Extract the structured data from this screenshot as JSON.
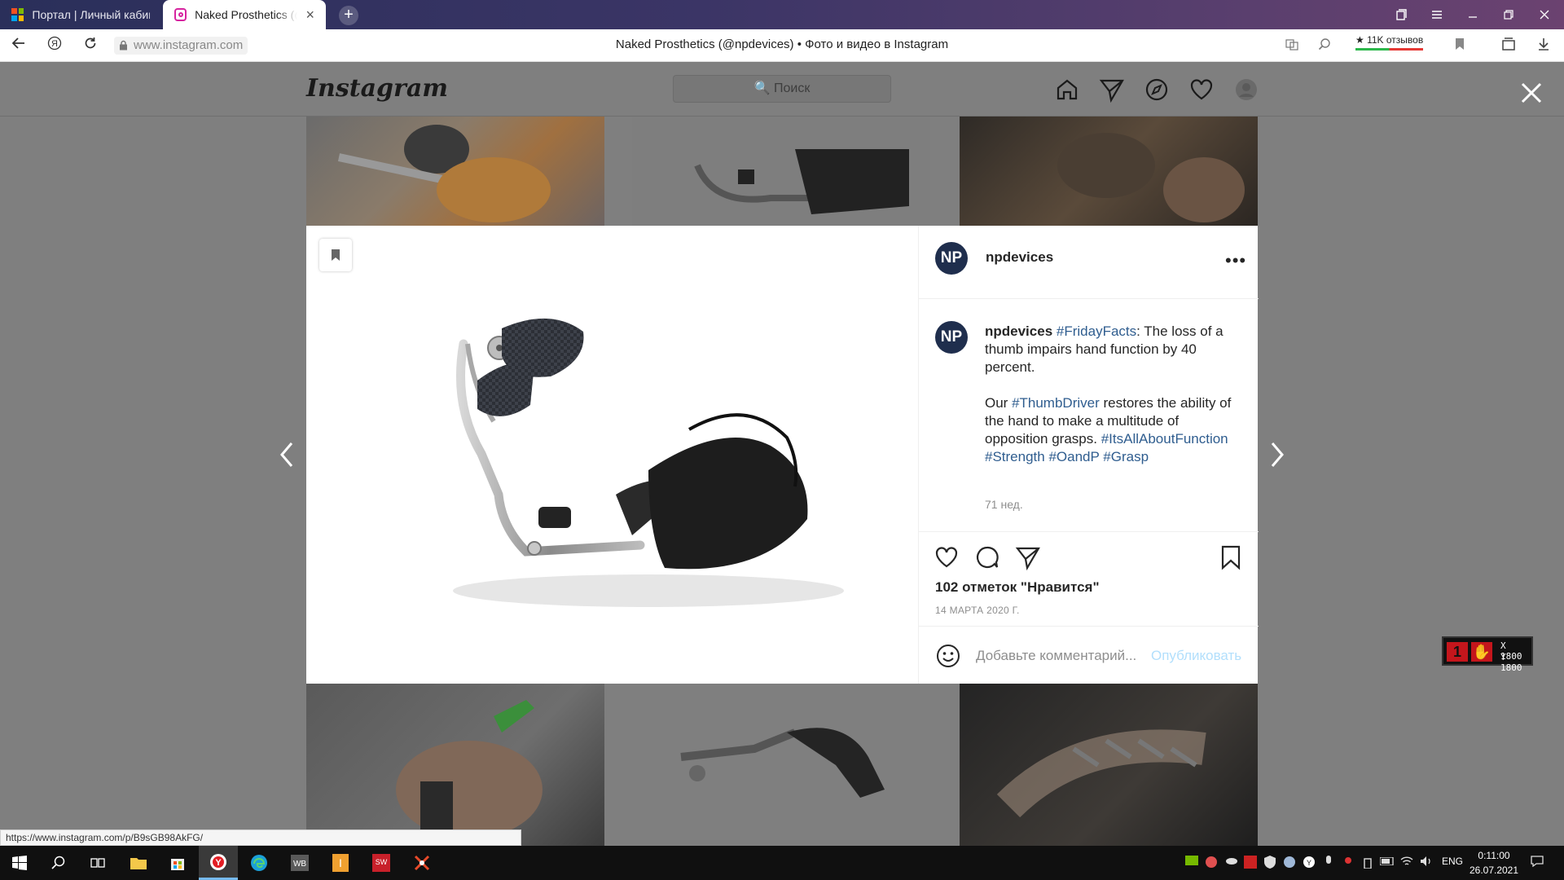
{
  "browser": {
    "tabs": [
      {
        "label": "Портал | Личный кабинет",
        "active": false
      },
      {
        "label": "Naked Prosthetics (@npdevices)",
        "active": true
      }
    ],
    "new_tab_symbol": "+",
    "tab_close_symbol": "×",
    "url": "www.instagram.com",
    "page_title": "Naked Prosthetics (@npdevices) • Фото и видео в Instagram",
    "reviews_badge": "★ 11K отзывов",
    "status_url": "https://www.instagram.com/p/B9sGB98AkFG/"
  },
  "instagram": {
    "logo": "Instagram",
    "search_placeholder": "🔍 Поиск"
  },
  "post": {
    "username": "npdevices",
    "avatar_initials": "NP",
    "more_symbol": "•••",
    "caption": {
      "username": "npdevices",
      "hashtag_friday": "#FridayFacts",
      "line1_rest": ": The loss of a thumb impairs hand function by 40 percent.",
      "line2_prefix": "Our ",
      "hashtag_thumbdriver": "#ThumbDriver",
      "line2_rest": " restores the ability of the hand to make a multitude of opposition grasps.",
      "hashtags_tail": [
        "#ItsAllAboutFunction",
        "#Strength",
        "#OandP",
        "#Grasp"
      ]
    },
    "time_ago": "71 нед.",
    "likes_count": "102",
    "likes_text": " отметок \"Нравится\"",
    "date": "14 МАРТА 2020 Г.",
    "comment_placeholder": "Добавьте комментарий...",
    "publish_label": "Опубликовать"
  },
  "overlay_widget": {
    "x_label": "X 1800",
    "y_label": "Y 1800"
  },
  "taskbar": {
    "language": "ENG",
    "time": "0:11:00",
    "date": "26.07.2021"
  },
  "colors": {
    "hashtag": "#2f5d8f",
    "publish_disabled": "#b2dffc",
    "avatar_bg": "#1f2e4d"
  }
}
